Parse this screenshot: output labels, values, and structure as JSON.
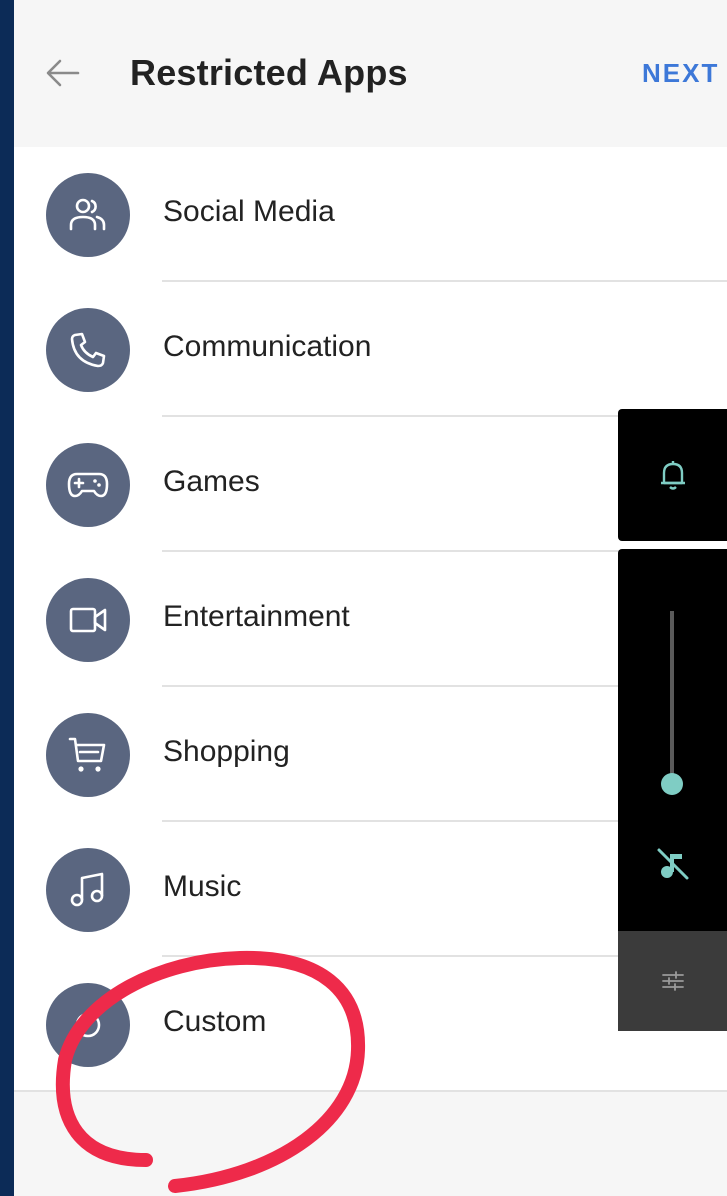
{
  "header": {
    "title": "Restricted Apps",
    "next_label": "NEXT",
    "back_icon": "arrow-left-icon"
  },
  "categories": [
    {
      "label": "Social Media",
      "icon": "people-icon"
    },
    {
      "label": "Communication",
      "icon": "phone-icon"
    },
    {
      "label": "Games",
      "icon": "gamepad-icon"
    },
    {
      "label": "Entertainment",
      "icon": "video-camera-icon"
    },
    {
      "label": "Shopping",
      "icon": "cart-icon"
    },
    {
      "label": "Music",
      "icon": "music-note-icon"
    },
    {
      "label": "Custom",
      "icon": "custom-icon"
    }
  ],
  "volume_panel": {
    "ringer_icon": "bell-icon",
    "mute_icon": "music-off-icon",
    "settings_icon": "sliders-icon",
    "level": 0.0,
    "accent_color": "#7fcdc4"
  },
  "annotation": {
    "shape": "hand-drawn-circle",
    "color": "#ee2a4a"
  },
  "colors": {
    "avatar_bg": "#5a6680",
    "accent": "#3d78d8",
    "frame": "#0c2b57"
  }
}
